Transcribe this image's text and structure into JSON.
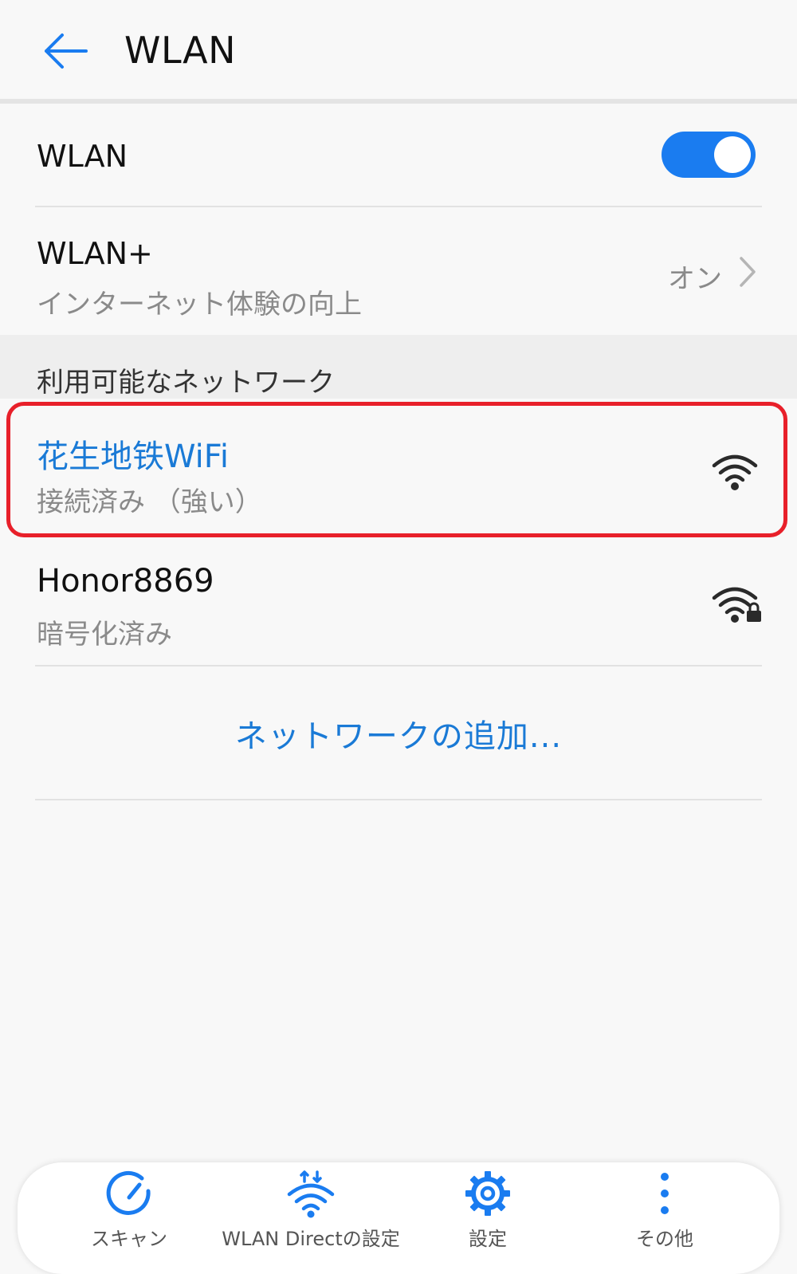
{
  "header": {
    "title": "WLAN"
  },
  "wlan_toggle": {
    "label": "WLAN",
    "state": "on"
  },
  "wlan_plus": {
    "label": "WLAN+",
    "subtitle": "インターネット体験の向上",
    "value": "オン"
  },
  "available_networks": {
    "title": "利用可能なネットワーク",
    "items": [
      {
        "name": "花生地铁WiFi",
        "status": "接続済み （強い）",
        "secured": false
      },
      {
        "name": "Honor8869",
        "status": "暗号化済み",
        "secured": true
      }
    ]
  },
  "add_network_label": "ネットワークの追加...",
  "bottom_bar": {
    "items": [
      {
        "label": "スキャン",
        "icon": "scan-icon"
      },
      {
        "label": "WLAN Directの設定",
        "icon": "wlan-direct-icon"
      },
      {
        "label": "設定",
        "icon": "gear-icon"
      },
      {
        "label": "その他",
        "icon": "more-vertical-icon"
      }
    ]
  },
  "colors": {
    "accent": "#1a7cf0",
    "link": "#1a7ad6",
    "highlight_border": "#e8202a"
  }
}
